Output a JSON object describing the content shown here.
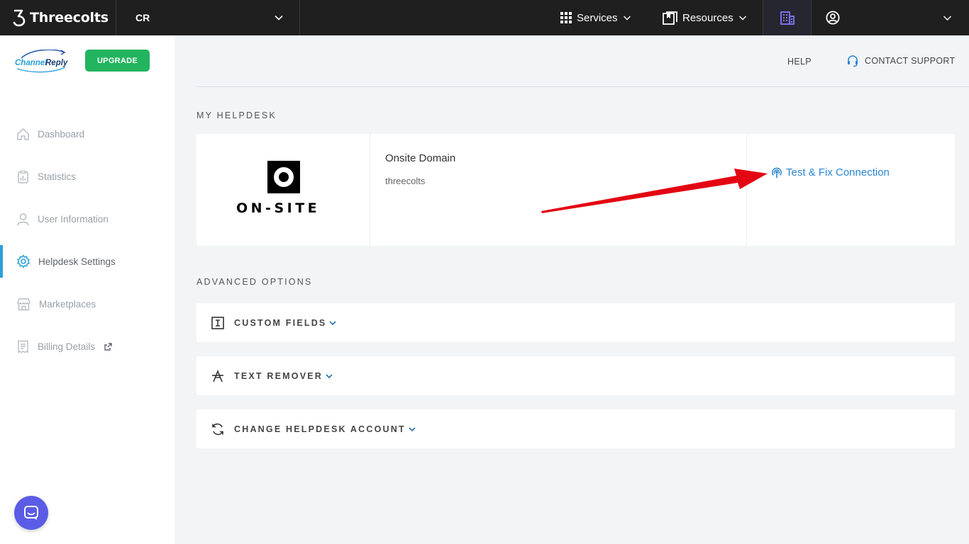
{
  "topbar": {
    "brand": "Threecolts",
    "account": "CR",
    "services_label": "Services",
    "resources_label": "Resources"
  },
  "sidebar": {
    "logo": "ChannelReply",
    "upgrade_label": "UPGRADE",
    "items": [
      {
        "label": "Dashboard",
        "icon": "home-icon"
      },
      {
        "label": "Statistics",
        "icon": "clipboard-chart-icon"
      },
      {
        "label": "User Information",
        "icon": "user-icon"
      },
      {
        "label": "Helpdesk Settings",
        "icon": "gear-icon",
        "active": true
      },
      {
        "label": "Marketplaces",
        "icon": "store-icon"
      },
      {
        "label": "Billing Details",
        "icon": "receipt-icon",
        "external": true
      }
    ]
  },
  "header": {
    "help_label": "HELP",
    "support_label": "CONTACT SUPPORT"
  },
  "my_helpdesk": {
    "title": "MY HELPDESK",
    "logo_text": "ON-SITE",
    "domain_title": "Onsite Domain",
    "domain_value": "threecolts",
    "action_label": "Test & Fix Connection"
  },
  "advanced": {
    "title": "ADVANCED OPTIONS",
    "options": [
      {
        "label": "CUSTOM FIELDS",
        "icon": "text-field-icon"
      },
      {
        "label": "TEXT REMOVER",
        "icon": "strikethrough-icon"
      },
      {
        "label": "CHANGE HELPDESK ACCOUNT",
        "icon": "refresh-icon"
      }
    ]
  },
  "colors": {
    "topbar": "#1f1f1f",
    "accent": "#2a9fd8",
    "upgrade": "#22b45f",
    "link": "#2a86d4",
    "annotation_arrow": "#e30613",
    "chat": "#5b5ce6"
  }
}
